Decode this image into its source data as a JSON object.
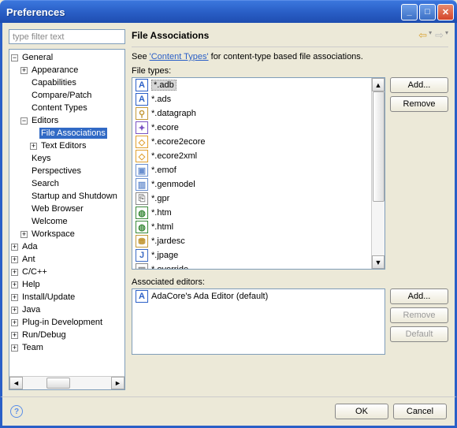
{
  "window": {
    "title": "Preferences"
  },
  "filter": {
    "placeholder": "type filter text"
  },
  "tree": {
    "items": [
      {
        "label": "General",
        "level": 0,
        "expander": "−"
      },
      {
        "label": "Appearance",
        "level": 1,
        "expander": "+"
      },
      {
        "label": "Capabilities",
        "level": 1,
        "expander": ""
      },
      {
        "label": "Compare/Patch",
        "level": 1,
        "expander": ""
      },
      {
        "label": "Content Types",
        "level": 1,
        "expander": ""
      },
      {
        "label": "Editors",
        "level": 1,
        "expander": "−"
      },
      {
        "label": "File Associations",
        "level": 2,
        "expander": "",
        "selected": true
      },
      {
        "label": "Text Editors",
        "level": 2,
        "expander": "+"
      },
      {
        "label": "Keys",
        "level": 1,
        "expander": ""
      },
      {
        "label": "Perspectives",
        "level": 1,
        "expander": ""
      },
      {
        "label": "Search",
        "level": 1,
        "expander": ""
      },
      {
        "label": "Startup and Shutdown",
        "level": 1,
        "expander": ""
      },
      {
        "label": "Web Browser",
        "level": 1,
        "expander": ""
      },
      {
        "label": "Welcome",
        "level": 1,
        "expander": ""
      },
      {
        "label": "Workspace",
        "level": 1,
        "expander": "+"
      },
      {
        "label": "Ada",
        "level": 0,
        "expander": "+"
      },
      {
        "label": "Ant",
        "level": 0,
        "expander": "+"
      },
      {
        "label": "C/C++",
        "level": 0,
        "expander": "+"
      },
      {
        "label": "Help",
        "level": 0,
        "expander": "+"
      },
      {
        "label": "Install/Update",
        "level": 0,
        "expander": "+"
      },
      {
        "label": "Java",
        "level": 0,
        "expander": "+"
      },
      {
        "label": "Plug-in Development",
        "level": 0,
        "expander": "+"
      },
      {
        "label": "Run/Debug",
        "level": 0,
        "expander": "+"
      },
      {
        "label": "Team",
        "level": 0,
        "expander": "+"
      }
    ]
  },
  "panel": {
    "title": "File Associations",
    "desc_prefix": "See ",
    "desc_link": "'Content Types'",
    "desc_suffix": " for content-type based file associations.",
    "filetypes_label": "File types:",
    "editors_label": "Associated editors:"
  },
  "filetypes": [
    {
      "label": "*.adb",
      "icon": "A",
      "color": "#2a5fc7",
      "selected": true
    },
    {
      "label": "*.ads",
      "icon": "A",
      "color": "#2a5fc7"
    },
    {
      "label": "*.datagraph",
      "icon": "⚲",
      "color": "#c49a3a"
    },
    {
      "label": "*.ecore",
      "icon": "✦",
      "color": "#7a53c4"
    },
    {
      "label": "*.ecore2ecore",
      "icon": "◇",
      "color": "#e0a030"
    },
    {
      "label": "*.ecore2xml",
      "icon": "◇",
      "color": "#e0a030"
    },
    {
      "label": "*.emof",
      "icon": "▣",
      "color": "#6a90d0"
    },
    {
      "label": "*.genmodel",
      "icon": "▥",
      "color": "#6a90d0"
    },
    {
      "label": "*.gpr",
      "icon": "⎘",
      "color": "#888"
    },
    {
      "label": "*.htm",
      "icon": "◍",
      "color": "#3a8a3a"
    },
    {
      "label": "*.html",
      "icon": "◍",
      "color": "#3a8a3a"
    },
    {
      "label": "*.jardesc",
      "icon": "⛃",
      "color": "#c49a3a"
    },
    {
      "label": "*.jpage",
      "icon": "J",
      "color": "#3a6ac4"
    },
    {
      "label": "*.override",
      "icon": "▥",
      "color": "#888"
    }
  ],
  "editors": [
    {
      "label": "AdaCore's Ada Editor (default)",
      "icon": "A",
      "color": "#2a5fc7"
    }
  ],
  "buttons": {
    "add": "Add...",
    "remove": "Remove",
    "default": "Default",
    "ok": "OK",
    "cancel": "Cancel"
  }
}
